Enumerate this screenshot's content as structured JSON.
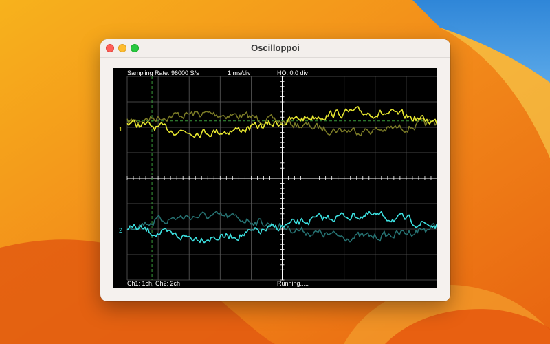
{
  "window": {
    "title": "Oscilloppoi"
  },
  "scope": {
    "sampling_rate": "Sampling Rate: 96000 S/s",
    "time_div": "1 ms/div",
    "horizontal_offset": "HO: 0.0 div",
    "channel_info": "Ch1: 1ch, Ch2: 2ch",
    "status": "Running.....",
    "channels": [
      {
        "label": "1",
        "color": "#e8e830"
      },
      {
        "label": "2",
        "color": "#3ce0e0"
      }
    ]
  },
  "colors": {
    "grid": "#5a5a5a",
    "axis": "#ffffff",
    "trigger": "#3a9a3a",
    "ch1": "#e8e830",
    "ch1_dim": "#8a8a2a",
    "ch2": "#3ce0e0",
    "ch2_dim": "#2a8080"
  }
}
